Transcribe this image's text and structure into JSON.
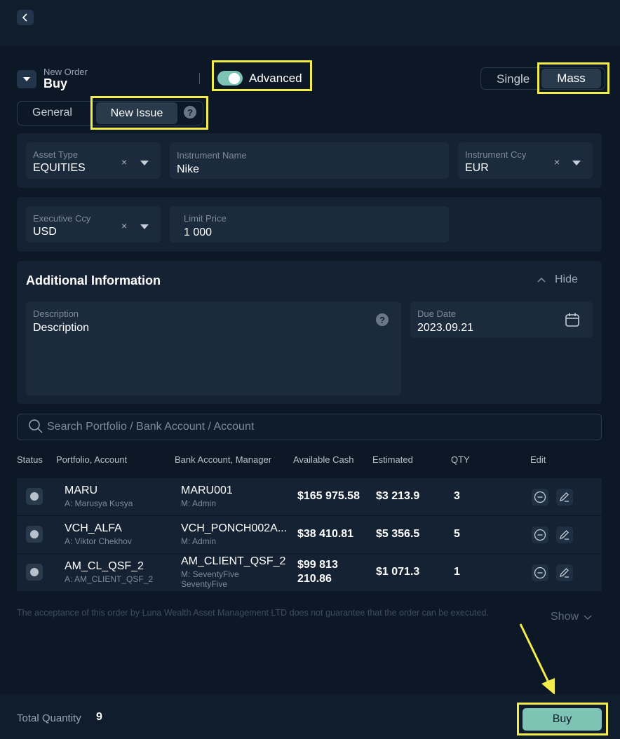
{
  "order": {
    "heading_small": "New Order",
    "heading_big": "Buy",
    "advanced_label": "Advanced",
    "advanced_on": true,
    "mode_single": "Single",
    "mode_mass": "Mass"
  },
  "tabs": {
    "general": "General",
    "new_issue": "New Issue",
    "help": "?"
  },
  "fields": {
    "asset_type": {
      "label": "Asset Type",
      "value": "EQUITIES",
      "clear": "×"
    },
    "instrument_name": {
      "label": "Instrument Name",
      "value": "Nike"
    },
    "instrument_ccy": {
      "label": "Instrument Ccy",
      "value": "EUR",
      "clear": "×"
    },
    "executive_ccy": {
      "label": "Executive Ccy",
      "value": "USD",
      "clear": "×"
    },
    "limit_price": {
      "label": "Limit Price",
      "value": "1 000"
    }
  },
  "additional": {
    "title": "Additional Information",
    "hide_label": "Hide",
    "description_label": "Description",
    "description_value": "Description",
    "help": "?",
    "due_date_label": "Due Date",
    "due_date_value": "2023.09.21"
  },
  "search": {
    "placeholder": "Search Portfolio / Bank Account / Account"
  },
  "table": {
    "headers": [
      "Status",
      "Portfolio, Account",
      "Bank Account, Manager",
      "Available Cash",
      "Estimated",
      "QTY",
      "Edit"
    ],
    "rows": [
      {
        "portfolio": "MARU",
        "account": "A: Marusya Kusya",
        "bank": "MARU001",
        "manager": "M: Admin",
        "cash": "$165 975.58",
        "estimated": "$3 213.9",
        "qty": "3"
      },
      {
        "portfolio": "VCH_ALFA",
        "account": "A: Viktor Chekhov",
        "bank": "VCH_PONCH002A...",
        "manager": "M: Admin",
        "cash": "$38 410.81",
        "estimated": "$5 356.5",
        "qty": "5"
      },
      {
        "portfolio": "AM_CL_QSF_2",
        "account": "A: AM_CLIENT_QSF_2",
        "bank": "AM_CLIENT_QSF_2",
        "manager": "M: SeventyFive",
        "manager2": "SeventyFive",
        "cash": "$99 813",
        "cash2": "210.86",
        "estimated": "$1 071.3",
        "qty": "1"
      }
    ]
  },
  "disclaimer": "The acceptance of this order by Luna Wealth Asset Management LTD does not guarantee that the order can be executed.",
  "show_label": "Show",
  "footer": {
    "total_label": "Total Quantity",
    "total_value": "9",
    "buy_label": "Buy"
  },
  "colors": {
    "accent": "#7ec4b5",
    "highlight": "#f3ec4a",
    "background": "#0c1826"
  }
}
